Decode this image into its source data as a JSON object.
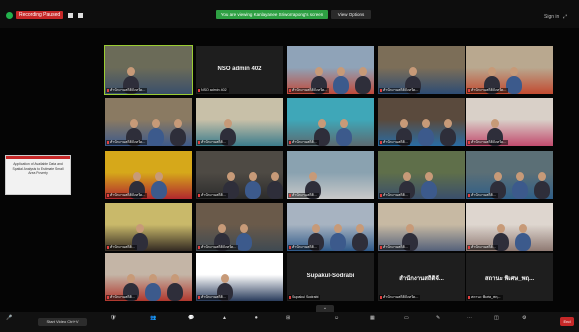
{
  "topbar": {
    "recording_label": "Recording Paused",
    "banner": "You are viewing Kanlayanee Sriworrapong's screen",
    "view_options": "View Options",
    "right_label": "Sign in"
  },
  "tiles": [
    {
      "name": "สำนักงานสถิติจังหวัด...",
      "camera": true,
      "active": true
    },
    {
      "name": "NSO admin 402",
      "camera": false,
      "center": "NSO admin 402"
    },
    {
      "name": "สำนักงานสถิติจังหวัด...",
      "camera": true
    },
    {
      "name": "สำนักงานสถิติจังหวัด...",
      "camera": true
    },
    {
      "name": "สำนักงานสถิติจังหวัด...",
      "camera": true
    },
    {
      "name": "สำนักงานสถิติจังหวัด...",
      "camera": true
    },
    {
      "name": "สำนักงานสถิติ...",
      "camera": true
    },
    {
      "name": "สำนักงานสถิติ...",
      "camera": true
    },
    {
      "name": "สำนักงานสถิติ...",
      "camera": true
    },
    {
      "name": "สำนักงานสถิติจังหวัด...",
      "camera": true
    },
    {
      "name": "สำนักงานสถิติจังหวัด...",
      "camera": true
    },
    {
      "name": "สำนักงานสถิติ...",
      "camera": true
    },
    {
      "name": "สำนักงานสถิติ...",
      "camera": true
    },
    {
      "name": "สำนักงานสถิติ...",
      "camera": true
    },
    {
      "name": "สำนักงานสถิติ...",
      "camera": true
    },
    {
      "name": "สำนักงานสถิติ...",
      "camera": true
    },
    {
      "name": "สำนักงานสถิติจังหวัด...",
      "camera": true
    },
    {
      "name": "สำนักงานสถิติ...",
      "camera": true
    },
    {
      "name": "สำนักงานสถิติ...",
      "camera": true
    },
    {
      "name": "สำนักงานสถิติ...",
      "camera": true
    },
    {
      "name": "สำนักงานสถิติ...",
      "camera": true
    },
    {
      "name": "สำนักงานสถิติ...",
      "camera": true
    },
    {
      "name": "Supakul Sodrabi",
      "camera": false,
      "center": "Supakul-Sodrabi"
    },
    {
      "name": "สำนักงานสถิติจังหวัด...",
      "camera": false,
      "center": "สำนักงานสถิติจั..."
    },
    {
      "name": "สถานะ พิเศษ_พฤ...",
      "camera": false,
      "center": "สถานะ พิเศษ_พฤ..."
    }
  ],
  "share": {
    "slide_text": "Application of Available Data and Spatial Analysis to Estimate Small Area Poverty"
  },
  "bottombar": {
    "video_chip": "Start Video Ctrl+V",
    "end_label": "End"
  }
}
